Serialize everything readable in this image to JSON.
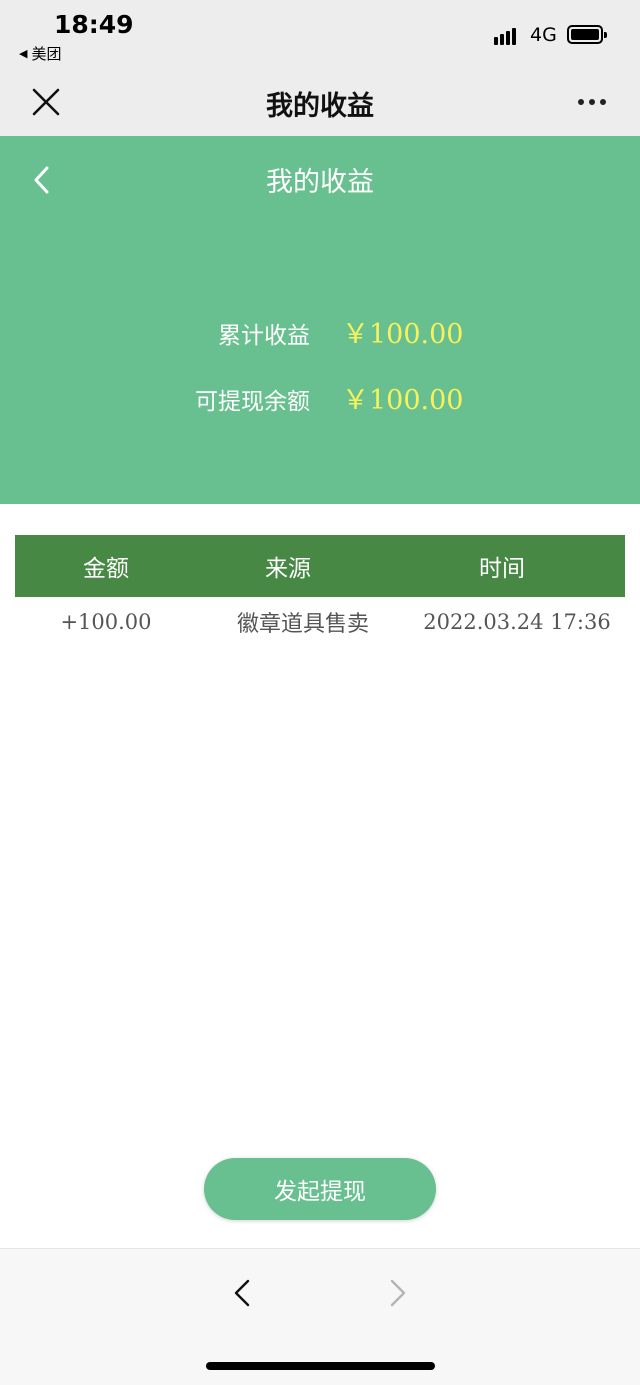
{
  "status_bar": {
    "time": "18:49",
    "back_app": "美团",
    "network": "4G"
  },
  "nav_bar": {
    "title": "我的收益",
    "close_icon": "close-icon",
    "more_icon": "more-dots-icon"
  },
  "hero": {
    "title": "我的收益",
    "total_label": "累计收益",
    "total_value": "￥100.00",
    "withdrawable_label": "可提现余额",
    "withdrawable_value": "￥100.00",
    "background_color": "#68c090",
    "value_color": "#f5f25c"
  },
  "table": {
    "headers": [
      "金额",
      "来源",
      "时间"
    ],
    "header_color": "#468844",
    "rows": [
      {
        "amount": "+100.00",
        "source": "徽章道具售卖",
        "time": "2022.03.24 17:36"
      }
    ]
  },
  "actions": {
    "withdraw_label": "发起提现"
  },
  "toolbar": {
    "back_icon": "chevron-left-icon",
    "forward_icon": "chevron-right-icon"
  }
}
